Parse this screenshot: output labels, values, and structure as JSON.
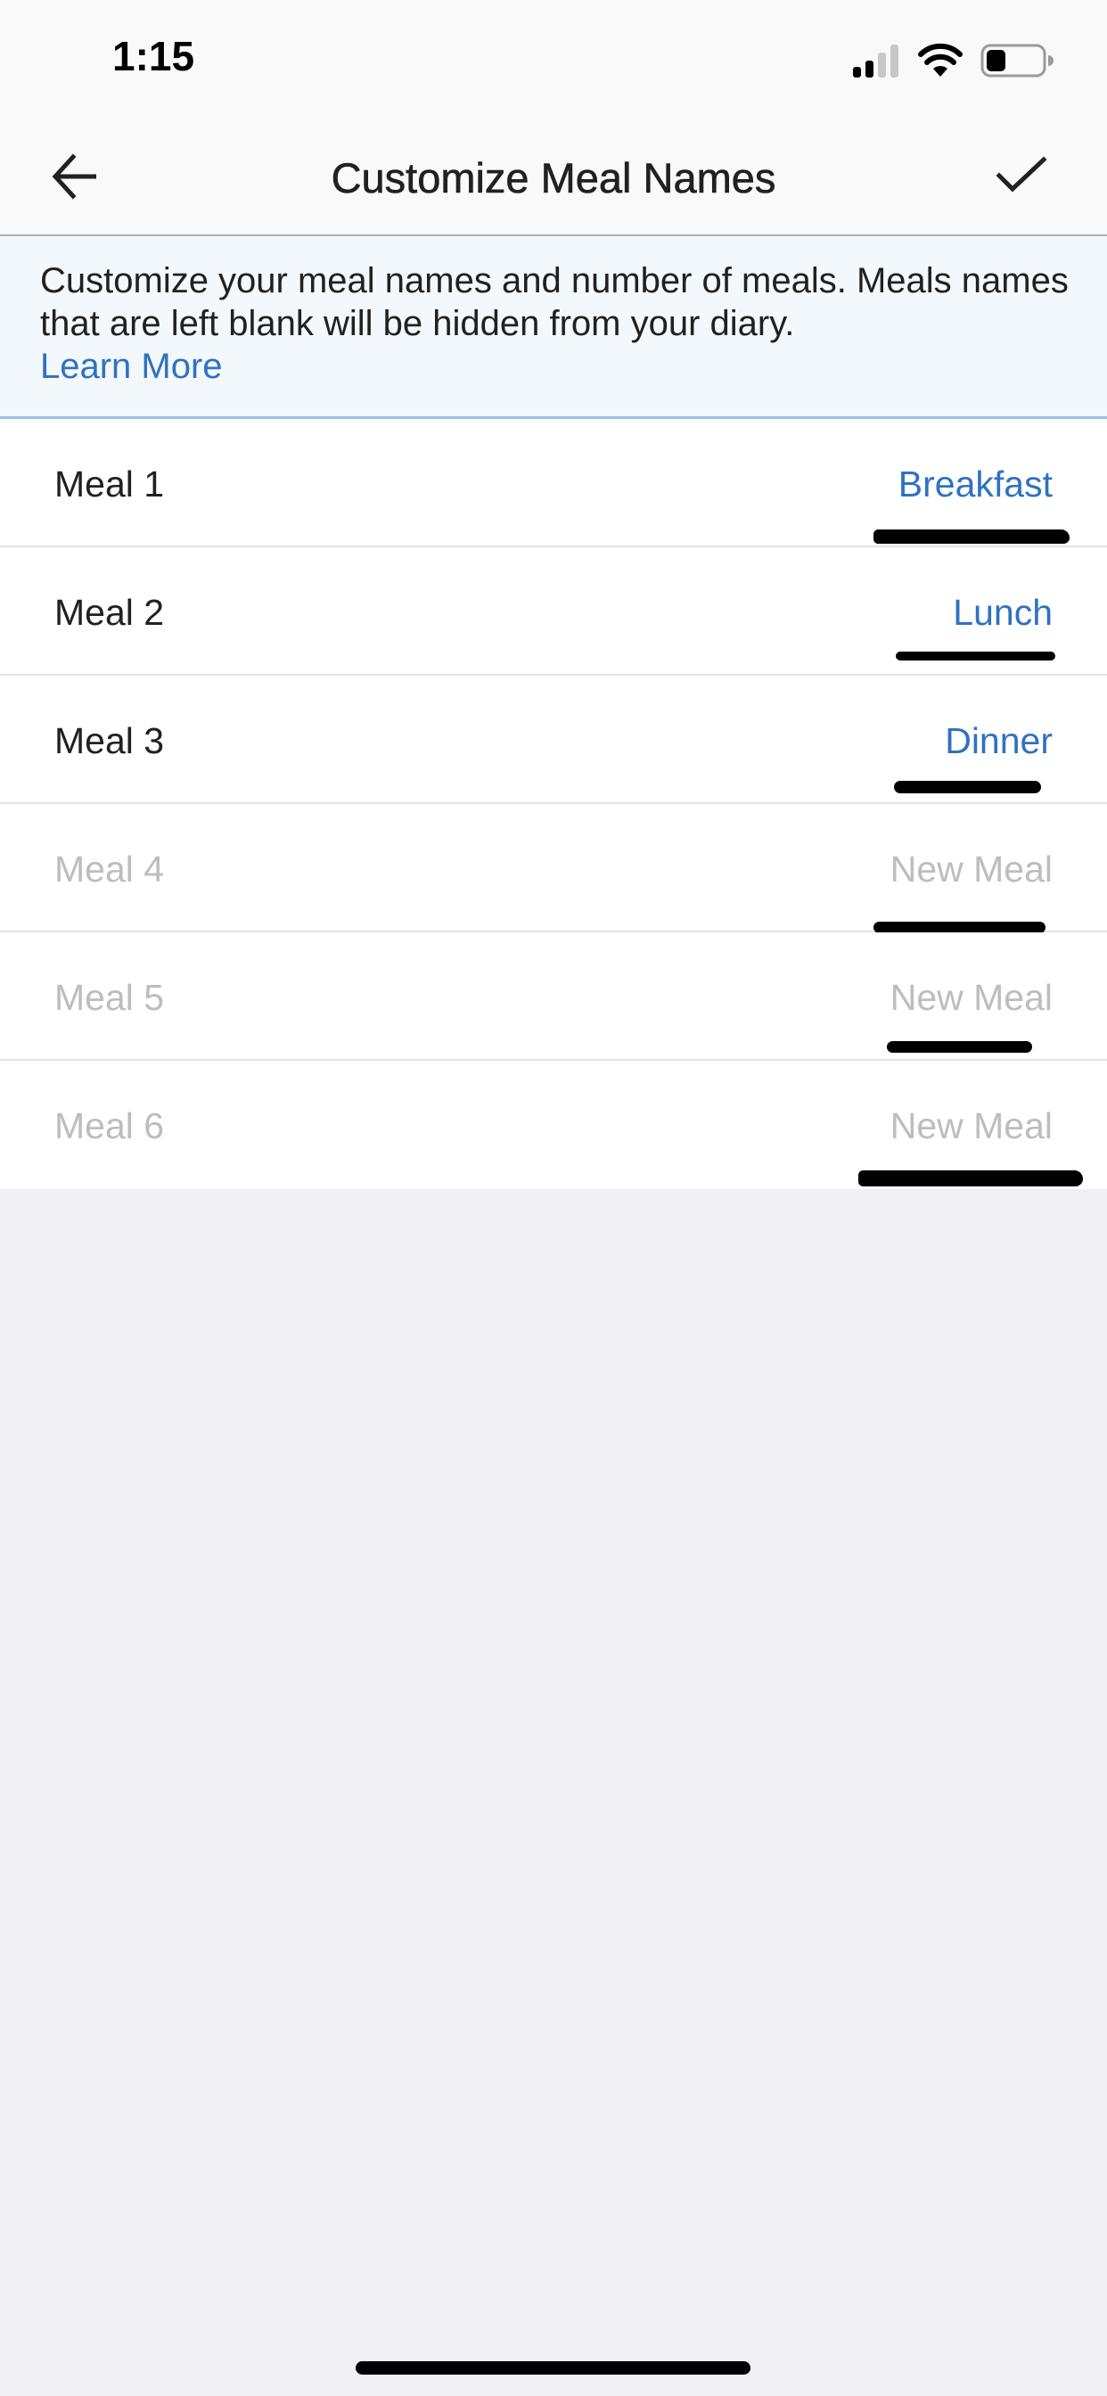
{
  "status_bar": {
    "time": "1:15",
    "icons": [
      "cellular-signal-icon",
      "wifi-icon",
      "battery-icon"
    ],
    "signal_bars_active": 2,
    "signal_bars_total": 4,
    "battery_level": 0.3
  },
  "nav": {
    "title": "Customize Meal Names",
    "back_icon": "arrow-left-icon",
    "save_icon": "checkmark-icon"
  },
  "info_banner": {
    "text": "Customize your meal names and number of meals. Meals names that are left blank will be hidden from your diary.",
    "link_label": "Learn More"
  },
  "meals": [
    {
      "label": "Meal 1",
      "value": "Breakfast",
      "placeholder": "New Meal",
      "enabled": true
    },
    {
      "label": "Meal 2",
      "value": "Lunch",
      "placeholder": "New Meal",
      "enabled": true
    },
    {
      "label": "Meal 3",
      "value": "Dinner",
      "placeholder": "New Meal",
      "enabled": true
    },
    {
      "label": "Meal 4",
      "value": "",
      "placeholder": "New Meal",
      "enabled": false
    },
    {
      "label": "Meal 5",
      "value": "",
      "placeholder": "New Meal",
      "enabled": false
    },
    {
      "label": "Meal 6",
      "value": "",
      "placeholder": "New Meal",
      "enabled": false
    }
  ],
  "colors": {
    "accent": "#2f72c0",
    "disabled_text": "#bdbdbd",
    "banner_bg": "#f3f8fc",
    "banner_border": "#94c2ea",
    "page_bg": "#efeff4"
  }
}
